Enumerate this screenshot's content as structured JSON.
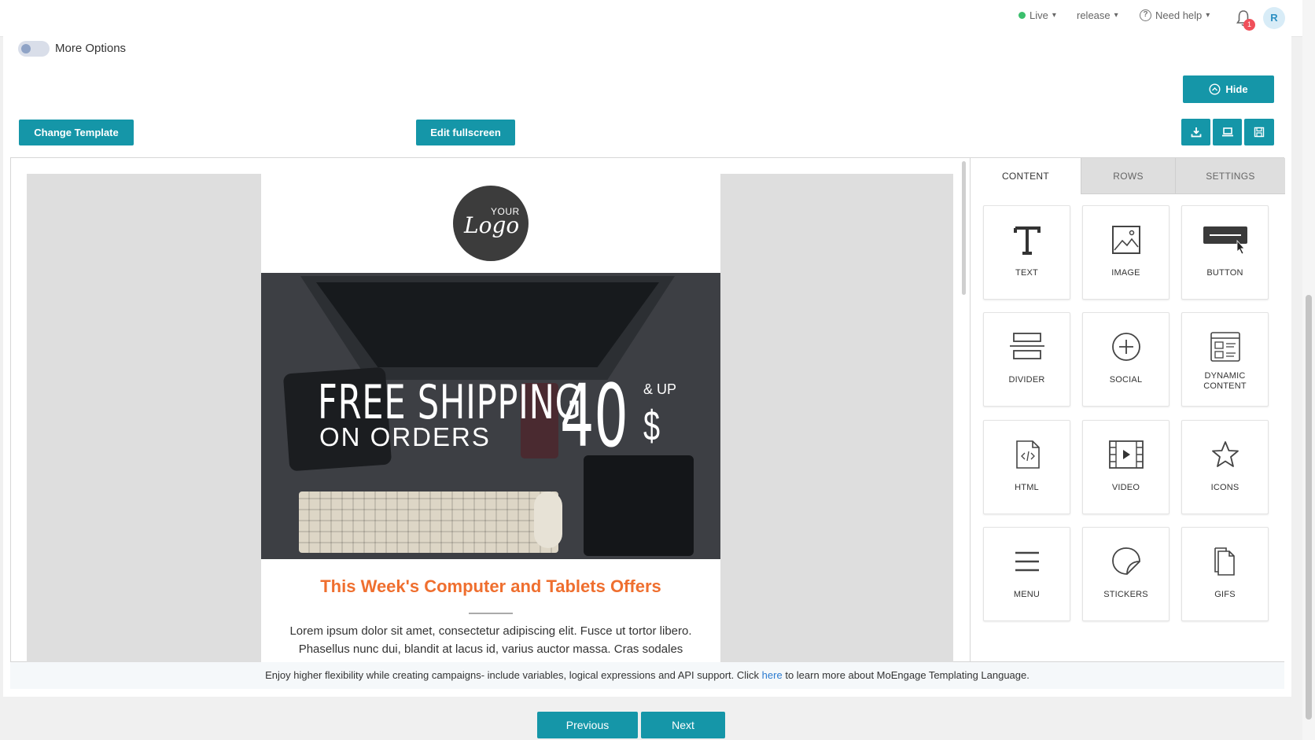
{
  "topbar": {
    "live_label": "Live",
    "release_label": "release",
    "help_label": "Need help",
    "notification_count": "1",
    "avatar_initial": "R"
  },
  "options": {
    "more_options_label": "More Options"
  },
  "toolbar": {
    "hide_label": "Hide",
    "change_template_label": "Change Template",
    "edit_fullscreen_label": "Edit fullscreen"
  },
  "email": {
    "logo_top": "YOUR",
    "logo_main": "Logo",
    "hero_line1": "FREE SHIPPING",
    "hero_line2": "ON ORDERS",
    "hero_amount": "40",
    "hero_up": "& UP",
    "hero_currency": "$",
    "offer_title": "This Week's Computer and Tablets Offers",
    "offer_text": "Lorem ipsum dolor sit amet, consectetur adipiscing elit. Fusce ut tortor libero. Phasellus nunc dui, blandit at lacus id, varius auctor massa. Cras sodales"
  },
  "sidebar": {
    "tabs": [
      "CONTENT",
      "ROWS",
      "SETTINGS"
    ],
    "tiles": [
      {
        "label": "TEXT",
        "icon": "text-icon"
      },
      {
        "label": "IMAGE",
        "icon": "image-icon"
      },
      {
        "label": "BUTTON",
        "icon": "button-icon"
      },
      {
        "label": "DIVIDER",
        "icon": "divider-icon"
      },
      {
        "label": "SOCIAL",
        "icon": "social-icon"
      },
      {
        "label": "DYNAMIC CONTENT",
        "icon": "dynamic-content-icon"
      },
      {
        "label": "HTML",
        "icon": "html-icon"
      },
      {
        "label": "VIDEO",
        "icon": "video-icon"
      },
      {
        "label": "ICONS",
        "icon": "star-icon"
      },
      {
        "label": "MENU",
        "icon": "menu-icon"
      },
      {
        "label": "STICKERS",
        "icon": "sticker-icon"
      },
      {
        "label": "GIFS",
        "icon": "gif-icon"
      }
    ]
  },
  "notice": {
    "before": "Enjoy higher flexibility while creating campaigns- include variables, logical expressions and API support. Click",
    "link": "here",
    "after": "to learn more about MoEngage Templating Language."
  },
  "footer": {
    "previous_label": "Previous",
    "next_label": "Next"
  },
  "colors": {
    "primary": "#1596a8",
    "offer_title": "#ef6f2f",
    "link": "#2b7bd0",
    "badge": "#f0505a",
    "live": "#3bbf6d"
  }
}
